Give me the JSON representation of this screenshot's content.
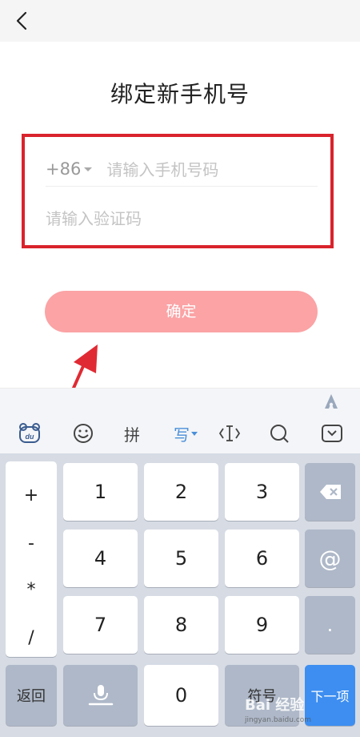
{
  "header": {
    "back_icon": "chevron-left-icon"
  },
  "page": {
    "title": "绑定新手机号"
  },
  "form": {
    "country_code": "+86",
    "phone_placeholder": "请输入手机号码",
    "code_placeholder": "请输入验证码"
  },
  "confirm_label": "确定",
  "keyboard": {
    "toolbar": {
      "pinyin": "拼",
      "handwrite": "写",
      "icons": [
        "baidu-du-icon",
        "emoji-icon",
        "cursor-icon",
        "search-icon",
        "collapse-keyboard-icon"
      ]
    },
    "symbols": [
      "+",
      "-",
      "*",
      "/"
    ],
    "digits": [
      "1",
      "2",
      "3",
      "4",
      "5",
      "6",
      "7",
      "8",
      "9",
      "0"
    ],
    "at": "@",
    "dot": ".",
    "back": "返回",
    "symbol": "符号",
    "next": "下一项"
  },
  "watermark": {
    "brand": "Bai 经验",
    "url": "jingyan.baidu.com"
  },
  "colors": {
    "highlight_border": "#d9232c",
    "confirm_bg": "#fba3a5",
    "arrow": "#e02a33",
    "next_key": "#3d8ef0"
  }
}
